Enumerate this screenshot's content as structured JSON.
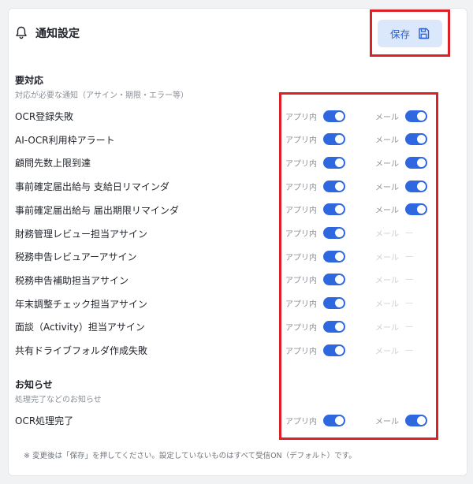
{
  "header": {
    "title": "通知設定",
    "save_label": "保存"
  },
  "sections": [
    {
      "title": "要対応",
      "description": "対応が必要な通知（アサイン・期限・エラー等）",
      "rows": [
        {
          "label": "OCR登録失敗",
          "app": true,
          "mail": true
        },
        {
          "label": "AI-OCR利用枠アラート",
          "app": true,
          "mail": true
        },
        {
          "label": "顧問先数上限到達",
          "app": true,
          "mail": true
        },
        {
          "label": "事前確定届出給与 支給日リマインダ",
          "app": true,
          "mail": true
        },
        {
          "label": "事前確定届出給与 届出期限リマインダ",
          "app": true,
          "mail": true
        },
        {
          "label": "財務管理レビュー担当アサイン",
          "app": true,
          "mail": null
        },
        {
          "label": "税務申告レビュアーアサイン",
          "app": true,
          "mail": null
        },
        {
          "label": "税務申告補助担当アサイン",
          "app": true,
          "mail": null
        },
        {
          "label": "年末調整チェック担当アサイン",
          "app": true,
          "mail": null
        },
        {
          "label": "面談（Activity）担当アサイン",
          "app": true,
          "mail": null
        },
        {
          "label": "共有ドライブフォルダ作成失敗",
          "app": true,
          "mail": null
        }
      ]
    },
    {
      "title": "お知らせ",
      "description": "処理完了などのお知らせ",
      "rows": [
        {
          "label": "OCR処理完了",
          "app": true,
          "mail": true
        }
      ]
    }
  ],
  "labels": {
    "app": "アプリ内",
    "mail": "メール",
    "unavailable": "—"
  },
  "footnote": "※ 変更後は「保存」を押してください。設定していないものはすべて受信ON（デフォルト）です。",
  "colors": {
    "accent": "#2f67df",
    "highlight": "#dd1f26",
    "save_bg": "#dbe7fb"
  }
}
